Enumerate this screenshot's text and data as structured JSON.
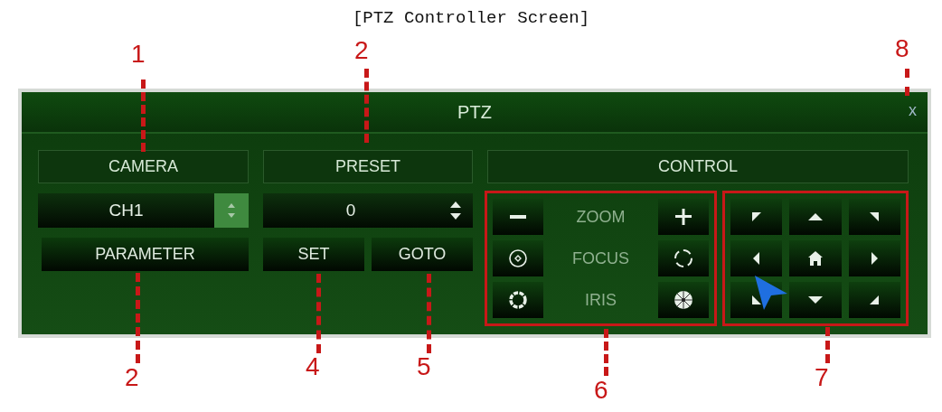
{
  "caption": "[PTZ Controller Screen]",
  "window": {
    "title": "PTZ",
    "close": "x"
  },
  "camera": {
    "header": "CAMERA",
    "value": "CH1",
    "button": "PARAMETER"
  },
  "preset": {
    "header": "PRESET",
    "value": "0",
    "buttons": [
      "SET",
      "GOTO"
    ]
  },
  "control": {
    "header": "CONTROL",
    "rows": [
      {
        "label": "ZOOM",
        "kind": "zoom"
      },
      {
        "label": "FOCUS",
        "kind": "focus"
      },
      {
        "label": "IRIS",
        "kind": "iris"
      }
    ],
    "pad": [
      {
        "kind": "up-left"
      },
      {
        "kind": "up"
      },
      {
        "kind": "up-right"
      },
      {
        "kind": "left"
      },
      {
        "kind": "home"
      },
      {
        "kind": "right"
      },
      {
        "kind": "down-left"
      },
      {
        "kind": "down"
      },
      {
        "kind": "down-right"
      }
    ]
  },
  "callouts": [
    "1",
    "2",
    "8",
    "2",
    "4",
    "5",
    "6",
    "7"
  ]
}
